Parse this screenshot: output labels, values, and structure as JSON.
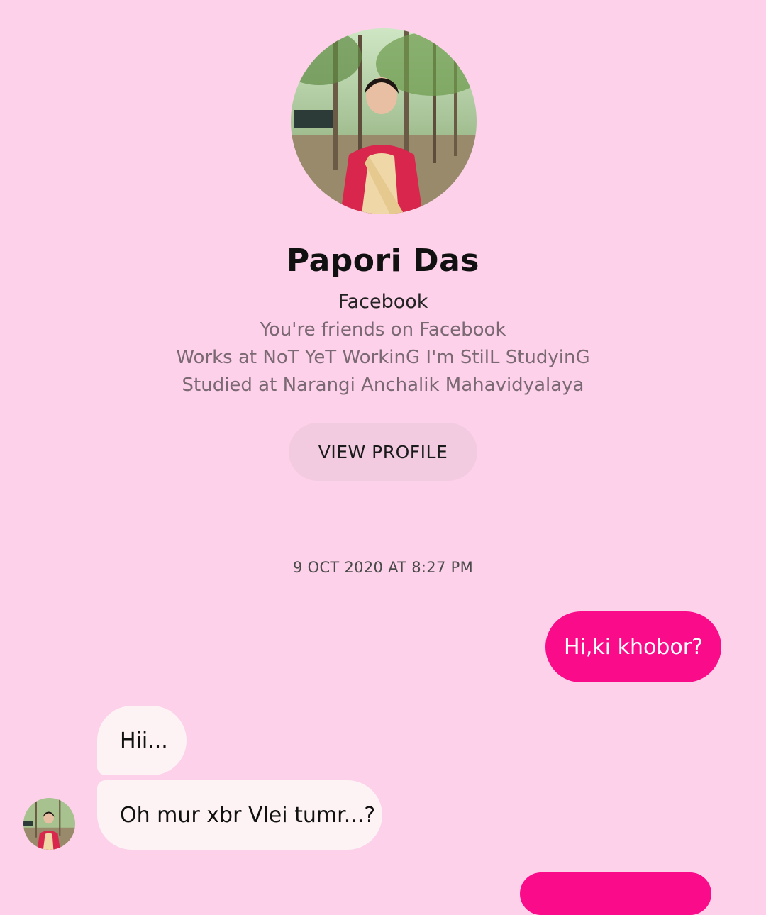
{
  "contact": {
    "name": "Papori Das",
    "platform": "Facebook",
    "info": [
      "You're friends on Facebook",
      "Works at NoT YeT WorkinG I'm StilL StudyinG",
      "Studied at Narangi Anchalik Mahavidyalaya"
    ],
    "view_profile_label": "VIEW PROFILE",
    "avatar_icon": "profile-photo"
  },
  "conversation": {
    "timestamp": "9 OCT 2020 AT 8:27 PM",
    "messages": [
      {
        "direction": "outgoing",
        "text": "Hi,ki khobor?"
      },
      {
        "direction": "incoming",
        "text": "Hii..."
      },
      {
        "direction": "incoming",
        "text": "Oh mur xbr Vlei tumr...?"
      }
    ]
  },
  "colors": {
    "background": "#fdd1ea",
    "outgoing_bubble": "#f90b8a",
    "incoming_bubble": "#fdf3f4",
    "view_profile_button": "#f3cbe0"
  }
}
